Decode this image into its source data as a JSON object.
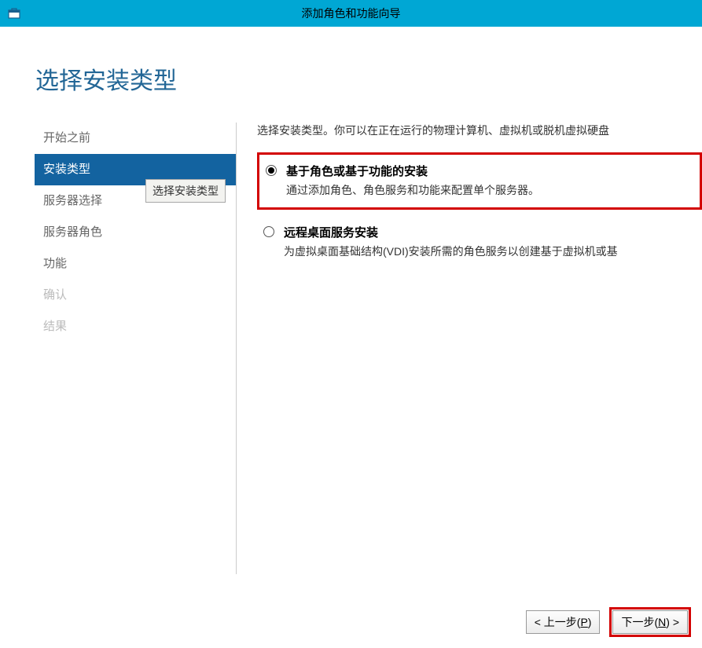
{
  "titlebar": {
    "title": "添加角色和功能向导"
  },
  "page": {
    "title": "选择安装类型"
  },
  "sidebar": {
    "items": [
      {
        "label": "开始之前",
        "active": false,
        "disabled": false
      },
      {
        "label": "安装类型",
        "active": true,
        "disabled": false
      },
      {
        "label": "服务器选择",
        "active": false,
        "disabled": false
      },
      {
        "label": "服务器角色",
        "active": false,
        "disabled": false
      },
      {
        "label": "功能",
        "active": false,
        "disabled": false
      },
      {
        "label": "确认",
        "active": false,
        "disabled": true
      },
      {
        "label": "结果",
        "active": false,
        "disabled": true
      }
    ],
    "tooltip": "选择安装类型"
  },
  "main": {
    "intro": "选择安装类型。你可以在正在运行的物理计算机、虚拟机或脱机虚拟硬盘",
    "options": [
      {
        "title": "基于角色或基于功能的安装",
        "desc": "通过添加角色、角色服务和功能来配置单个服务器。",
        "selected": true,
        "highlighted": true
      },
      {
        "title": "远程桌面服务安装",
        "desc": "为虚拟桌面基础结构(VDI)安装所需的角色服务以创建基于虚拟机或基",
        "selected": false,
        "highlighted": false
      }
    ]
  },
  "footer": {
    "prev_label": "< 上一步(P)",
    "next_label": "下一步(N) >",
    "next_highlighted": true,
    "prev_accesskey": "P",
    "next_accesskey": "N"
  }
}
